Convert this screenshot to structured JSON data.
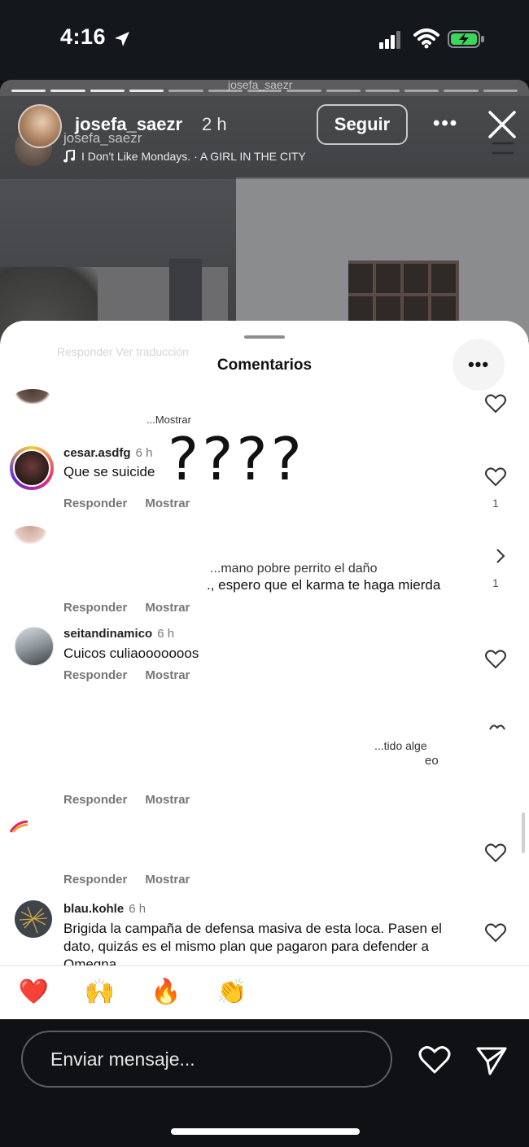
{
  "status_bar": {
    "time": "4:16"
  },
  "story": {
    "ghost_username": "josefa_saezr",
    "username": "josefa_saezr",
    "time": "2 h",
    "username_ghost": "josefa_saezr",
    "music": "I Don't Like Mondays. · A GIRL IN THE CITY",
    "follow_label": "Seguir",
    "more_label": "•••",
    "progress_segments": 13,
    "progress_watched": 4
  },
  "comments": {
    "ghost_actions": "Responder        Ver traducción",
    "title": "Comentarios",
    "more_label": "•••",
    "top_cutoff": "...Mostrar",
    "items": [
      {
        "user": "cesar.asdfg",
        "time": "6 h",
        "text": "Que se suicide",
        "reply": "Responder",
        "show": "Mostrar",
        "likes": "1",
        "overlay": "????"
      },
      {
        "text_line1": "...mano pobre perrito el daño",
        "text_line2": "., espero que el karma te haga mierda",
        "reply": "Responder",
        "show": "Mostrar",
        "likes": "1"
      },
      {
        "user": "seitandinamico",
        "time": "6 h",
        "text": "Cuicos culiaooooooos",
        "reply": "Responder",
        "show": "Mostrar"
      },
      {
        "text_fragment": "...tido alge",
        "text_fragment2": "eo",
        "reply": "Responder",
        "show": "Mostrar"
      },
      {
        "reply": "Responder",
        "show": "Mostrar"
      },
      {
        "user": "blau.kohle",
        "time": "6 h",
        "text": "Brigida la campaña de defensa masiva de esta loca. Pasen el dato, quizás es el mismo plan que pagaron para defender a Omegna."
      }
    ]
  },
  "emojis": [
    "❤️",
    "🙌",
    "🔥",
    "👏",
    "😢",
    "😍",
    "😮",
    "😂"
  ],
  "message_input": {
    "placeholder": "Enviar mensaje..."
  },
  "colors": {
    "background": "#0f1115",
    "sheet": "#ffffff",
    "heart_emoji": "#e0245e"
  }
}
